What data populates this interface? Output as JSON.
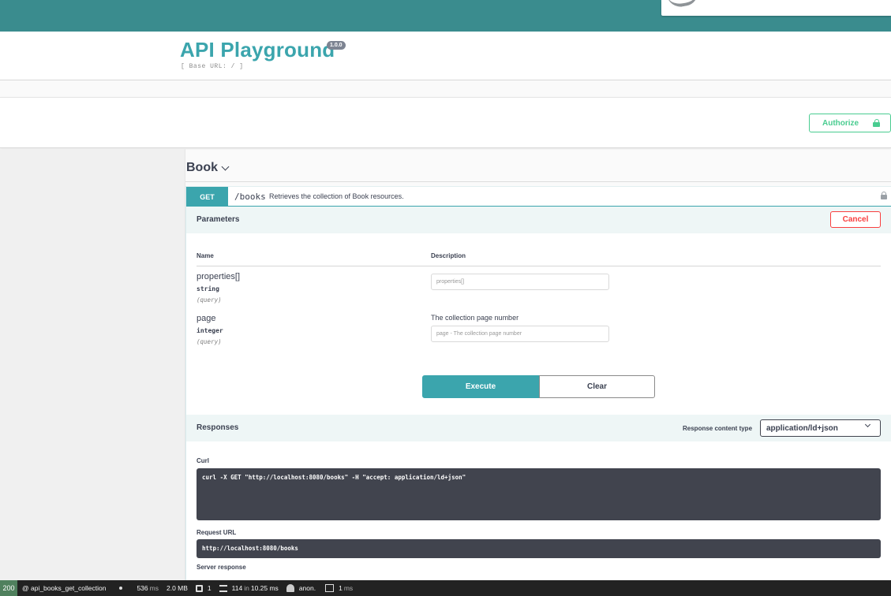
{
  "header": {
    "title": "API Playground",
    "version": "1.0.0",
    "base_url": "[ Base URL: / ]"
  },
  "scheme": {
    "authorize_label": "Authorize"
  },
  "tag": {
    "name": "Book"
  },
  "operation": {
    "method": "GET",
    "path": "/books",
    "summary": "Retrieves the collection of Book resources.",
    "parameters_title": "Parameters",
    "cancel_label": "Cancel",
    "col_name": "Name",
    "col_description": "Description",
    "params": [
      {
        "name": "properties[]",
        "type": "string",
        "in": "(query)",
        "description": "",
        "placeholder": "properties[]"
      },
      {
        "name": "page",
        "type": "integer",
        "in": "(query)",
        "description": "The collection page number",
        "placeholder": "page - The collection page number"
      }
    ],
    "execute_label": "Execute",
    "clear_label": "Clear"
  },
  "responses": {
    "title": "Responses",
    "content_type_label": "Response content type",
    "content_type_value": "application/ld+json",
    "curl_label": "Curl",
    "curl_command": "curl -X GET \"http://localhost:8080/books\" -H \"accept: application/ld+json\"",
    "request_url_label": "Request URL",
    "request_url": "http://localhost:8080/books",
    "server_response_label": "Server response"
  },
  "statusbar": {
    "status_code": "200",
    "route": "@ api_books_get_collection",
    "time_value": "536",
    "time_unit": "ms",
    "memory": "2.0 MB",
    "forms": "1",
    "db_queries": "114",
    "db_in": "in",
    "db_time": "10.25 ms",
    "user": "anon.",
    "twig_time": "1",
    "twig_unit": "ms"
  },
  "colors": {
    "topbar": "#3a8c8e",
    "accent": "#3ba5ad",
    "authorize": "#49cc90",
    "cancel": "#f93e3e",
    "status_ok": "#4f805d"
  }
}
